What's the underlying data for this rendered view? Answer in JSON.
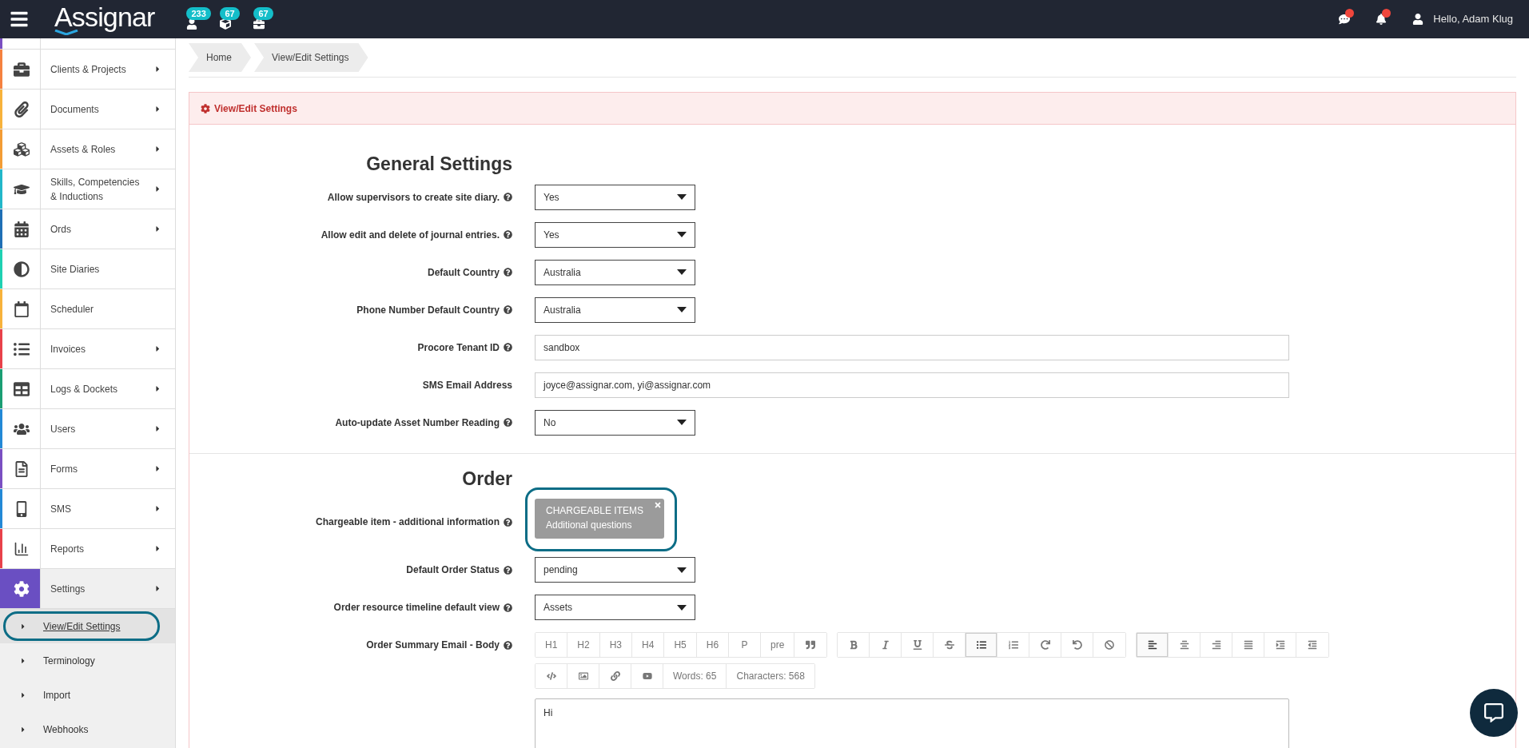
{
  "top_bar": {
    "logo": "Assignar",
    "badges": [
      {
        "kind": "user",
        "count": "233"
      },
      {
        "kind": "cube",
        "count": "67"
      },
      {
        "kind": "briefcase",
        "count": "67"
      }
    ],
    "alerts": [
      {
        "kind": "chat",
        "unread": true
      },
      {
        "kind": "bell",
        "unread": true
      }
    ],
    "greeting": "Hello, Adam Klug"
  },
  "sidebar": {
    "items": [
      {
        "label": "Clients & Projects",
        "kind": "briefcase",
        "color": "#f5813f",
        "has_submenu": true,
        "expanded": false
      },
      {
        "label": "Documents",
        "kind": "paperclip",
        "color": "#f7b23b",
        "has_submenu": true,
        "expanded": false
      },
      {
        "label": "Assets & Roles",
        "kind": "cubes",
        "color": "#f39c35",
        "has_submenu": true,
        "expanded": false
      },
      {
        "label": "Skills, Competencies & Inductions",
        "kind": "graduation-cap",
        "color": "#22b7c9",
        "has_submenu": true,
        "expanded": false
      },
      {
        "label": "Ords",
        "kind": "calendar-grid",
        "color": "#1f6fb5",
        "has_submenu": true,
        "expanded": false
      },
      {
        "label": "Site Diaries",
        "kind": "half-circle",
        "color": "#1fd1b2",
        "has_submenu": false,
        "expanded": false
      },
      {
        "label": "Scheduler",
        "kind": "calendar",
        "color": "#f7b23b",
        "has_submenu": false,
        "expanded": false
      },
      {
        "label": "Invoices",
        "kind": "list",
        "color": "#e8414a",
        "has_submenu": true,
        "expanded": false
      },
      {
        "label": "Logs & Dockets",
        "kind": "table",
        "color": "#1a9e73",
        "has_submenu": true,
        "expanded": false
      },
      {
        "label": "Users",
        "kind": "users",
        "color": "#2389d6",
        "has_submenu": true,
        "expanded": false
      },
      {
        "label": "Forms",
        "kind": "file",
        "color": "#7a4fc2",
        "has_submenu": true,
        "expanded": false
      },
      {
        "label": "SMS",
        "kind": "mobile",
        "color": "#2389d6",
        "has_submenu": true,
        "expanded": false
      },
      {
        "label": "Reports",
        "kind": "bar-chart",
        "color": "#e8414a",
        "has_submenu": true,
        "expanded": false
      },
      {
        "label": "Settings",
        "kind": "cog",
        "color": "#6a4fc2",
        "has_submenu": true,
        "expanded": true,
        "children": [
          {
            "label": "View/Edit Settings",
            "selected": true,
            "annotated": true
          },
          {
            "label": "Terminology",
            "selected": false,
            "annotated": false
          },
          {
            "label": "Import",
            "selected": false,
            "annotated": false
          },
          {
            "label": "Webhooks",
            "selected": false,
            "annotated": false
          }
        ]
      }
    ]
  },
  "breadcrumb": [
    "Home",
    "View/Edit Settings"
  ],
  "panel": {
    "title": "View/Edit Settings",
    "sections": [
      {
        "heading": "General Settings",
        "fields": [
          {
            "label": "Allow supervisors to create site diary.",
            "help": true,
            "kind": "select",
            "value": "Yes"
          },
          {
            "label": "Allow edit and delete of journal entries.",
            "help": true,
            "kind": "select",
            "value": "Yes"
          },
          {
            "label": "Default Country",
            "help": true,
            "kind": "select",
            "value": "Australia"
          },
          {
            "label": "Phone Number Default Country",
            "help": true,
            "kind": "select",
            "value": "Australia"
          },
          {
            "label": "Procore Tenant ID",
            "help": true,
            "kind": "text",
            "value": "sandbox"
          },
          {
            "label": "SMS Email Address",
            "help": false,
            "kind": "text",
            "value": "joyce@assignar.com, yi@assignar.com"
          },
          {
            "label": "Auto-update Asset Number Reading",
            "help": true,
            "kind": "select",
            "value": "No"
          }
        ]
      },
      {
        "heading": "Order",
        "fields": [
          {
            "label": "Chargeable item - additional information",
            "help": true,
            "kind": "chips",
            "annotated": true,
            "chips": [
              {
                "title": "CHARGEABLE ITEMS",
                "subtitle": "Additional questions"
              }
            ]
          },
          {
            "label": "Default Order Status",
            "help": true,
            "kind": "select",
            "value": "pending"
          },
          {
            "label": "Order resource timeline default view",
            "help": true,
            "kind": "select",
            "value": "Assets"
          },
          {
            "label": "Order Summary Email - Body",
            "help": true,
            "kind": "editor",
            "toolbar": [
              [
                [
                  {
                    "kind": "text",
                    "label": "H1",
                    "active": false
                  },
                  {
                    "kind": "text",
                    "label": "H2",
                    "active": false
                  },
                  {
                    "kind": "text",
                    "label": "H3",
                    "active": false
                  },
                  {
                    "kind": "text",
                    "label": "H4",
                    "active": false
                  },
                  {
                    "kind": "text",
                    "label": "H5",
                    "active": false
                  },
                  {
                    "kind": "text",
                    "label": "H6",
                    "active": false
                  },
                  {
                    "kind": "text",
                    "label": "P",
                    "active": false
                  },
                  {
                    "kind": "text",
                    "label": "pre",
                    "active": false
                  },
                  {
                    "kind": "quote",
                    "active": false
                  }
                ],
                [
                  {
                    "kind": "bold",
                    "active": false
                  },
                  {
                    "kind": "italic",
                    "active": false
                  },
                  {
                    "kind": "underline",
                    "active": false
                  },
                  {
                    "kind": "strike",
                    "active": false
                  },
                  {
                    "kind": "ul",
                    "active": true
                  },
                  {
                    "kind": "ol",
                    "active": false
                  },
                  {
                    "kind": "redo",
                    "active": false
                  },
                  {
                    "kind": "undo",
                    "active": false
                  },
                  {
                    "kind": "ban",
                    "active": false
                  }
                ],
                [
                  {
                    "kind": "align-left",
                    "active": true
                  },
                  {
                    "kind": "align-center",
                    "active": false
                  },
                  {
                    "kind": "align-right",
                    "active": false
                  },
                  {
                    "kind": "align-justify",
                    "active": false
                  },
                  {
                    "kind": "indent",
                    "active": false
                  },
                  {
                    "kind": "outdent",
                    "active": false
                  }
                ]
              ],
              [
                [
                  {
                    "kind": "code",
                    "active": false
                  },
                  {
                    "kind": "image",
                    "active": false
                  },
                  {
                    "kind": "link",
                    "active": false
                  },
                  {
                    "kind": "video",
                    "active": false
                  },
                  {
                    "kind": "text",
                    "label": "Words: 65",
                    "active": false
                  },
                  {
                    "kind": "text",
                    "label": "Characters: 568",
                    "active": false
                  }
                ]
              ]
            ],
            "value": "Hi"
          }
        ]
      }
    ]
  }
}
